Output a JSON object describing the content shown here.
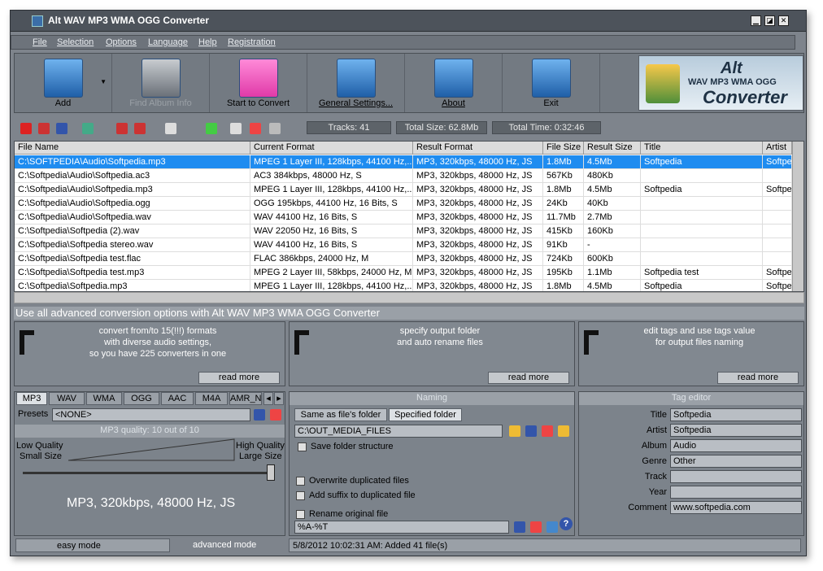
{
  "app": {
    "title": "Alt WAV MP3 WMA OGG Converter"
  },
  "menu": [
    "File",
    "Selection",
    "Options",
    "Language",
    "Help",
    "Registration"
  ],
  "toolbar": {
    "add": "Add",
    "find_album": "Find Album Info",
    "start": "Start to Convert",
    "settings": "General Settings...",
    "about": "About",
    "exit": "Exit"
  },
  "logo": {
    "l1": "Alt",
    "l2": "WAV MP3 WMA OGG",
    "l3": "Converter"
  },
  "stats": {
    "tracks": "Tracks: 41",
    "size": "Total Size: 62.8Mb",
    "time": "Total Time: 0:32:46"
  },
  "grid": {
    "columns": [
      "File Name",
      "Current Format",
      "Result Format",
      "File Size",
      "Result Size",
      "Title",
      "Artist"
    ],
    "rows": [
      [
        "C:\\SOFTPEDIA\\Audio\\Softpedia.mp3",
        "MPEG 1 Layer III, 128kbps, 44100 Hz,...",
        "MP3, 320kbps, 48000 Hz, JS",
        "1.8Mb",
        "4.5Mb",
        "Softpedia",
        "Softpe"
      ],
      [
        "C:\\Softpedia\\Audio\\Softpedia.ac3",
        "AC3 384kbps, 48000 Hz, S",
        "MP3, 320kbps, 48000 Hz, JS",
        "567Kb",
        "480Kb",
        "",
        ""
      ],
      [
        "C:\\Softpedia\\Audio\\Softpedia.mp3",
        "MPEG 1 Layer III, 128kbps, 44100 Hz,...",
        "MP3, 320kbps, 48000 Hz, JS",
        "1.8Mb",
        "4.5Mb",
        "Softpedia",
        "Softpe"
      ],
      [
        "C:\\Softpedia\\Audio\\Softpedia.ogg",
        "OGG 195kbps, 44100 Hz, 16 Bits, S",
        "MP3, 320kbps, 48000 Hz, JS",
        "24Kb",
        "40Kb",
        "",
        ""
      ],
      [
        "C:\\Softpedia\\Audio\\Softpedia.wav",
        "WAV 44100 Hz, 16 Bits, S",
        "MP3, 320kbps, 48000 Hz, JS",
        "11.7Mb",
        "2.7Mb",
        "",
        ""
      ],
      [
        "C:\\Softpedia\\Softpedia (2).wav",
        "WAV 22050 Hz, 16 Bits, S",
        "MP3, 320kbps, 48000 Hz, JS",
        "415Kb",
        "160Kb",
        "",
        ""
      ],
      [
        "C:\\Softpedia\\Softpedia stereo.wav",
        "WAV 44100 Hz, 16 Bits, S",
        "MP3, 320kbps, 48000 Hz, JS",
        "91Kb",
        "-",
        "",
        ""
      ],
      [
        "C:\\Softpedia\\Softpedia test.flac",
        "FLAC 386kbps, 24000 Hz, M",
        "MP3, 320kbps, 48000 Hz, JS",
        "724Kb",
        "600Kb",
        "",
        ""
      ],
      [
        "C:\\Softpedia\\Softpedia test.mp3",
        "MPEG 2 Layer III, 58kbps, 24000 Hz, M",
        "MP3, 320kbps, 48000 Hz, JS",
        "195Kb",
        "1.1Mb",
        "Softpedia test",
        "Softpe"
      ],
      [
        "C:\\Softpedia\\Softpedia.mp3",
        "MPEG 1 Layer III, 128kbps, 44100 Hz,...",
        "MP3, 320kbps, 48000 Hz, JS",
        "1.8Mb",
        "4.5Mb",
        "Softpedia",
        "Softpe"
      ]
    ]
  },
  "banner": "Use all advanced conversion options with Alt WAV MP3 WMA OGG Converter",
  "info": [
    {
      "text": "convert from/to 15(!!!) formats\nwith diverse audio settings,\nso you have 225 converters in one",
      "more": "read more"
    },
    {
      "text": "specify output folder\nand auto rename files",
      "more": "read more"
    },
    {
      "text": "edit tags and use tags value\nfor output files naming",
      "more": "read more"
    }
  ],
  "format_tabs": [
    "MP3",
    "WAV",
    "WMA",
    "OGG",
    "AAC",
    "M4A",
    "AMR_N"
  ],
  "presets": {
    "label": "Presets",
    "value": "<NONE>"
  },
  "quality": {
    "header": "MP3 quality: 10 out of 10",
    "low1": "Low Quality",
    "low2": "Small Size",
    "high1": "High Quality",
    "high2": "Large Size",
    "result": "MP3, 320kbps, 48000 Hz, JS",
    "level": 1.0
  },
  "naming": {
    "header": "Naming",
    "tab1": "Same as file's folder",
    "tab2": "Specified folder",
    "folder": "C:\\OUT_MEDIA_FILES",
    "save_structure": "Save folder structure",
    "overwrite": "Overwrite duplicated files",
    "suffix": "Add suffix to duplicated file",
    "rename": "Rename original file",
    "pattern": "%A-%T"
  },
  "tags": {
    "header": "Tag editor",
    "labels": [
      "Title",
      "Artist",
      "Album",
      "Genre",
      "Track",
      "Year",
      "Comment"
    ],
    "values": [
      "Softpedia",
      "Softpedia",
      "Audio",
      "Other",
      "",
      "",
      "www.softpedia.com"
    ]
  },
  "status": {
    "easy": "easy mode",
    "advanced": "advanced mode",
    "log": "5/8/2012 10:02:31 AM: Added 41 file(s)"
  },
  "colors": {
    "selection": "#1e8cf0",
    "chrome": "#7e848c"
  }
}
